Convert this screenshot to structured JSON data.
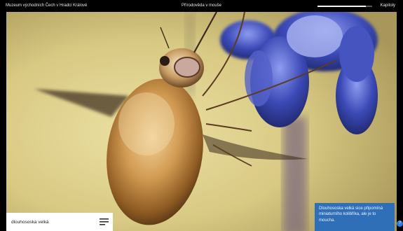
{
  "topbar": {
    "museum": "Muzeum východních Čech v Hradci Králové",
    "title": "Přírodověda v mouše",
    "chapters": "Kapitoly",
    "progress": 0.88
  },
  "photo": {
    "caption": "dlouhososka velká",
    "menu_icon": "menu-icon"
  },
  "info": {
    "text": "Dlouhososka velká sice připomíná miniaturního kolibříka, ale je to moucha."
  },
  "colors": {
    "topbar_bg": "#000000",
    "info_bg": "#2f6fb8",
    "flower": "#3c4fb8"
  }
}
